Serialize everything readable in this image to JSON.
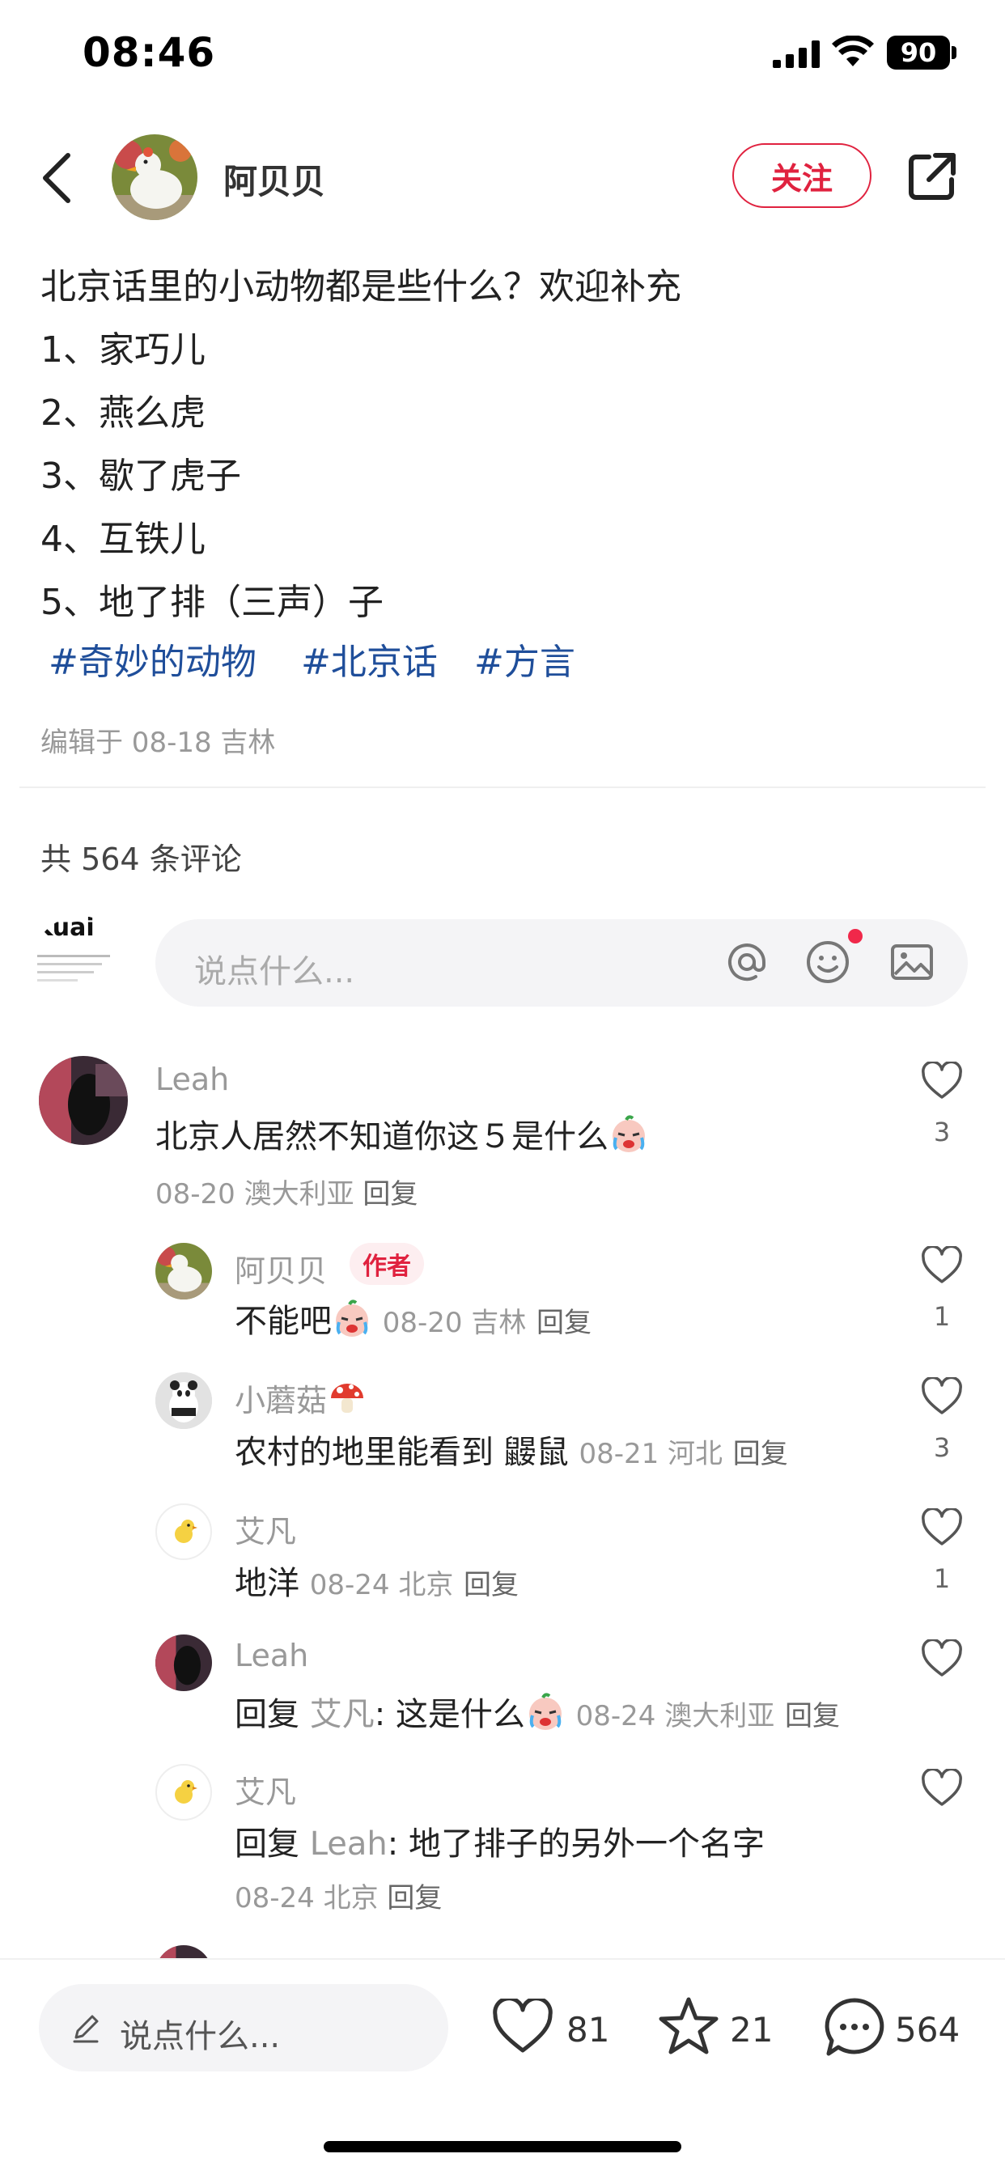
{
  "status_bar": {
    "time": "08:46",
    "battery": "90"
  },
  "header": {
    "author": "阿贝贝",
    "follow": "关注"
  },
  "post": {
    "lines": [
      "北京话里的小动物都是些什么？欢迎补充",
      "1、家巧儿",
      "2、燕么虎",
      "3、歇了虎子",
      "4、互铁儿",
      "5、地了排（三声）子"
    ],
    "hashtags": [
      "#奇妙的动物",
      "#北京话",
      "#方言"
    ],
    "edit_meta": "编辑于 08-18 吉林"
  },
  "comments_header": "共 564 条评论",
  "comment_input": {
    "placeholder": "说点什么...",
    "my_avatar_text": "Kuai"
  },
  "comments": [
    {
      "name": "Leah",
      "text": "北京人居然不知道你这５是什么",
      "meta_date": "08-20 澳大利亚",
      "reply": "回复",
      "likes": "3"
    }
  ],
  "replies": [
    {
      "name": "阿贝贝",
      "badge": "作者",
      "text": "不能吧",
      "meta": "08-20 吉林",
      "reply": "回复",
      "likes": "1"
    },
    {
      "name": "小蘑菇",
      "text": "农村的地里能看到 鼹鼠",
      "meta": "08-21 河北",
      "reply": "回复",
      "likes": "3"
    },
    {
      "name": "艾凡",
      "text": "地洋",
      "meta": "08-24 北京",
      "reply": "回复",
      "likes": "1"
    },
    {
      "name": "Leah",
      "reply_prefix": "回复",
      "reply_to": "艾凡",
      "text": ": 这是什么",
      "meta": "08-24 澳大利亚",
      "reply": "回复",
      "likes": ""
    },
    {
      "name": "艾凡",
      "reply_prefix": "回复",
      "reply_to": "Leah",
      "text": ": 地了排子的另外一个名字",
      "meta": "08-24 北京",
      "reply": "回复",
      "likes": ""
    }
  ],
  "bottom_bar": {
    "placeholder": "说点什么...",
    "likes": "81",
    "favorites": "21",
    "comments": "564"
  },
  "colors": {
    "accent": "#e0223f",
    "hashtag": "#1f4e9a",
    "muted": "#999999"
  }
}
